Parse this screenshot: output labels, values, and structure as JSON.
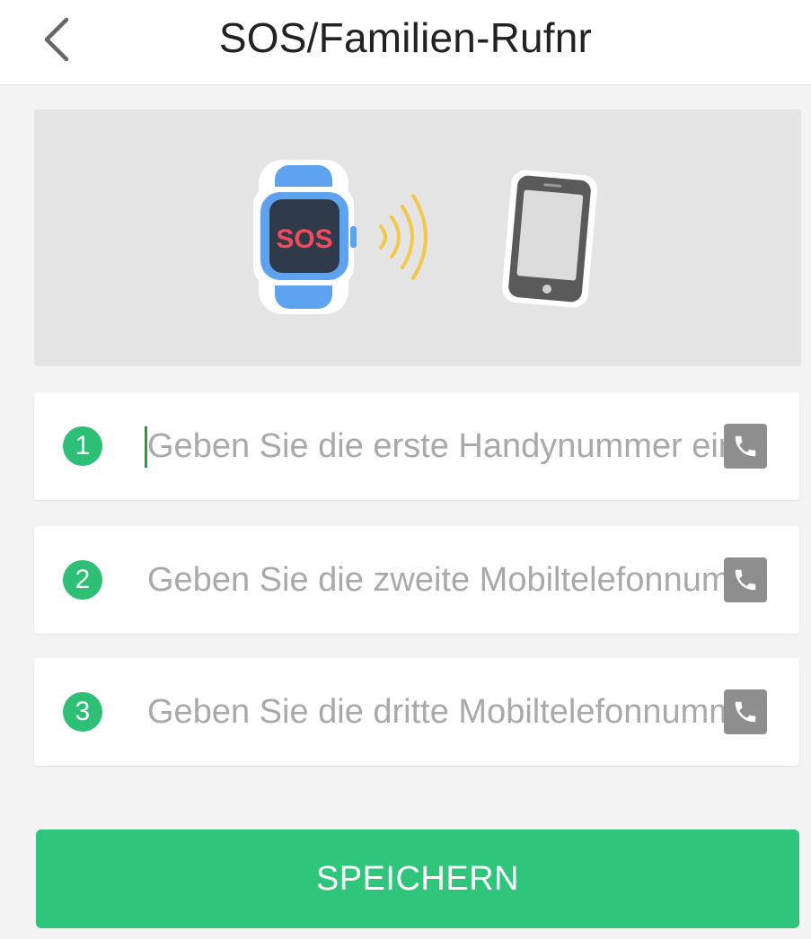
{
  "header": {
    "title": "SOS/Familien-Rufnr",
    "back_icon": "chevron-left-icon"
  },
  "banner": {
    "watch_screen_text": "SOS",
    "colors": {
      "watch_band": "#5ea3ef",
      "watch_screen": "#2f3a4a",
      "sos_text": "#f04a5c",
      "signal_waves": "#f1c94a",
      "phone_body": "#5a5a5a"
    }
  },
  "contacts": [
    {
      "number": "1",
      "value": "",
      "placeholder": "Geben Sie die erste Handynummer ein",
      "focused": true,
      "picker_icon": "phone-book-icon"
    },
    {
      "number": "2",
      "value": "",
      "placeholder": "Geben Sie die zweite Mobiltelefonnummer ein",
      "focused": false,
      "picker_icon": "phone-book-icon"
    },
    {
      "number": "3",
      "value": "",
      "placeholder": "Geben Sie die dritte Mobiltelefonnummer ein",
      "focused": false,
      "picker_icon": "phone-book-icon"
    }
  ],
  "save_button": {
    "label": "SPEICHERN"
  },
  "colors": {
    "accent": "#2fc57b",
    "badge": "#2ebf76",
    "icon_gray": "#8e8e8e",
    "background": "#f3f3f3"
  }
}
